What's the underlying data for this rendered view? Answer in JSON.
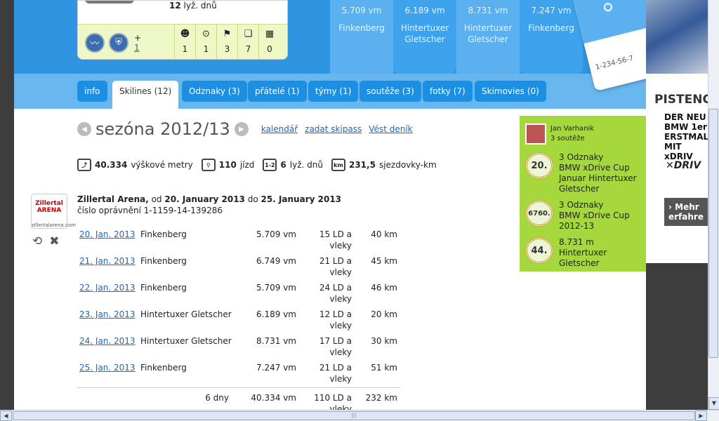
{
  "profile": {
    "days_value": "12",
    "days_label": "lyž. dnů",
    "plus": "+",
    "plus_count": "1",
    "stats": [
      {
        "icon": "smiley-icon",
        "glyph": "☻",
        "value": "1"
      },
      {
        "icon": "target-icon",
        "glyph": "⊙",
        "value": "1"
      },
      {
        "icon": "flag-icon",
        "glyph": "⚑",
        "value": "3"
      },
      {
        "icon": "book-icon",
        "glyph": "❏",
        "value": "7"
      },
      {
        "icon": "film-icon",
        "glyph": "▦",
        "value": "0"
      }
    ]
  },
  "resorts_top": [
    {
      "vm": "5.709 vm",
      "name": "Finkenberg"
    },
    {
      "vm": "6.189 vm",
      "name": "Hintertuxer Gletscher"
    },
    {
      "vm": "8.731 vm",
      "name": "Hintertuxer Gletscher"
    },
    {
      "vm": "7.247 vm",
      "name": "Finkenberg"
    }
  ],
  "skipass_number": "1-234-56-7",
  "tabs": {
    "info": "info",
    "skilines": "Skilines (12)",
    "badges": "Odznaky (3)",
    "friends": "přátelé (1)",
    "teams": "týmy (1)",
    "contests": "soutěže (3)",
    "photos": "fotky (7)",
    "skimovies": "Skimovies (0)"
  },
  "season": {
    "title": "sezóna 2012/13",
    "links": {
      "calendar": "kalendář",
      "enter_skipass": "zadat skipass",
      "diary": "Vést deník"
    }
  },
  "summary": [
    {
      "icon": "altitude-icon",
      "glyph": "⤴",
      "value": "40.334",
      "label": "výškové metry"
    },
    {
      "icon": "lift-icon",
      "glyph": "⚲",
      "value": "110",
      "label": "jízd"
    },
    {
      "icon": "days-icon",
      "glyph": "1-2",
      "value": "6",
      "label": "lyž. dnů"
    },
    {
      "icon": "km-icon",
      "glyph": "km",
      "value": "231,5",
      "label": "sjezdovky-km"
    }
  ],
  "pass": {
    "resort": "Zillertal Arena,",
    "from_label": "od",
    "from": "20. January 2013",
    "to_label": "do",
    "to": "25. January 2013",
    "permit": "číslo oprávnění 1-1159-14-139286",
    "logo_line1": "Zillertal ARENA",
    "logo_line2": "zillertalarena.com"
  },
  "visits": [
    {
      "date": "20. Jan. 2013",
      "location": "Finkenberg",
      "vm": "5.709 vm",
      "ld": "15 LD a vleky",
      "km": "40 km"
    },
    {
      "date": "21. Jan. 2013",
      "location": "Finkenberg",
      "vm": "6.749 vm",
      "ld": "21 LD a vleky",
      "km": "45 km"
    },
    {
      "date": "22. Jan. 2013",
      "location": "Finkenberg",
      "vm": "5.709 vm",
      "ld": "24 LD a vleky",
      "km": "46 km"
    },
    {
      "date": "23. Jan. 2013",
      "location": "Hintertuxer Gletscher",
      "vm": "6.189 vm",
      "ld": "12 LD a vleky",
      "km": "20 km"
    },
    {
      "date": "24. Jan. 2013",
      "location": "Hintertuxer Gletscher",
      "vm": "8.731 vm",
      "ld": "17 LD a vleky",
      "km": "30 km"
    },
    {
      "date": "25. Jan. 2013",
      "location": "Finkenberg",
      "vm": "7.247 vm",
      "ld": "21 LD a vleky",
      "km": "51 km"
    }
  ],
  "visits_total": {
    "days": "6 dny",
    "vm": "40.334 vm",
    "ld": "110 LD a vleky",
    "km": "232 km"
  },
  "achievements": {
    "user_name": "Jan Varhanik",
    "user_contests": "3 soutěže",
    "items": [
      {
        "rank": "20.",
        "line1": "3 Odznaky",
        "line2": "BMW xDrive Cup Januar Hintertuxer Gletscher"
      },
      {
        "rank": "6760.",
        "line1": "3 Odznaky",
        "line2": "BMW xDrive Cup 2012-13"
      },
      {
        "rank": "44.",
        "line1": "8.731 m",
        "line2": "Hintertuxer Gletscher"
      }
    ]
  },
  "ad": {
    "brand": "PISTENC",
    "copy": "DER NEU\nBMW 1er\nERSTMAL\nMIT xDRIV",
    "logo": "✕DRIV",
    "button": "› Mehr\nerfahre"
  },
  "colors": {
    "banner": "#2f95e0",
    "tab": "#1d8fe3",
    "link": "#1a66c4",
    "achievements_bg": "#a5d83c"
  }
}
